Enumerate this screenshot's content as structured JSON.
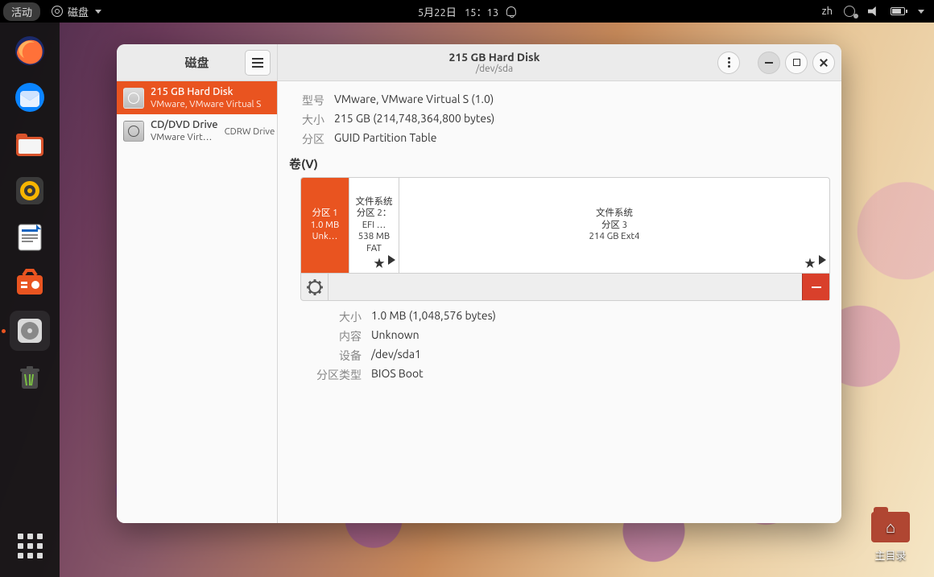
{
  "topbar": {
    "activities": "活动",
    "app_name": "磁盘",
    "date": "5月22日",
    "time": "15：13",
    "input_method": "zh"
  },
  "desktop": {
    "home_label": "主目录"
  },
  "window": {
    "left_title": "磁盘",
    "title": "215 GB Hard Disk",
    "subtitle": "/dev/sda"
  },
  "devices": [
    {
      "name": "215 GB Hard Disk",
      "sub": "VMware, VMware Virtual S",
      "sub2": "",
      "selected": true
    },
    {
      "name": "CD/DVD Drive",
      "sub": "VMware Virt…",
      "sub2": "CDRW Drive",
      "selected": false
    }
  ],
  "drive_info": {
    "model_k": "型号",
    "model_v": "VMware, VMware Virtual S (1.0)",
    "size_k": "大小",
    "size_v": "215 GB (214,748,364,800 bytes)",
    "part_k": "分区",
    "part_v": "GUID Partition Table"
  },
  "volumes_header": "卷(V)",
  "partitions": {
    "p1": {
      "l1": "分区 1",
      "l2": "1.0 MB Unk…"
    },
    "p2": {
      "l1": "文件系统",
      "l2": "分区 2：EFI …",
      "l3": "538 MB FAT"
    },
    "p3": {
      "l1": "文件系统",
      "l2": "分区 3",
      "l3": "214 GB Ext4"
    }
  },
  "selected_partition": {
    "size_k": "大小",
    "size_v": "1.0 MB (1,048,576 bytes)",
    "content_k": "内容",
    "content_v": "Unknown",
    "device_k": "设备",
    "device_v": "/dev/sda1",
    "type_k": "分区类型",
    "type_v": "BIOS Boot"
  }
}
